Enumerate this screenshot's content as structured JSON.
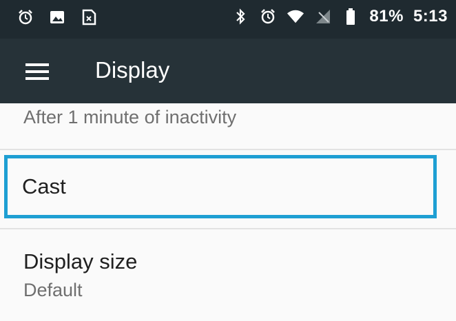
{
  "status_bar": {
    "battery_percent": "81%",
    "time": "5:13",
    "icons": [
      "alarm-icon",
      "image-icon",
      "sim-icon",
      "bluetooth-icon",
      "alarm-icon",
      "wifi-icon",
      "no-signal-icon",
      "battery-icon"
    ]
  },
  "toolbar": {
    "title": "Display"
  },
  "settings": {
    "sleep_summary": "After 1 minute of inactivity",
    "cast_label": "Cast",
    "display_size_label": "Display size",
    "display_size_value": "Default"
  },
  "colors": {
    "status_bar_bg": "#1f2a30",
    "toolbar_bg": "#263238",
    "highlight_border": "#1e9fd3",
    "page_bg": "#fafafa"
  }
}
